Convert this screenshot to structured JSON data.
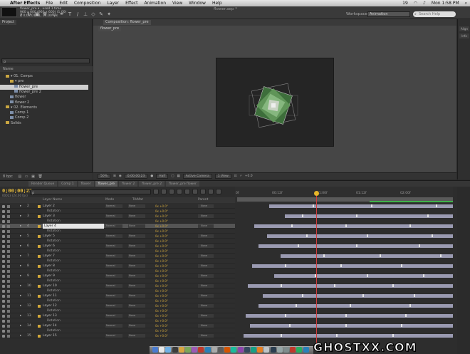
{
  "menubar": {
    "app": "After Effects",
    "items": [
      "File",
      "Edit",
      "Composition",
      "Layer",
      "Effect",
      "Animation",
      "View",
      "Window",
      "Help"
    ],
    "status": "19",
    "clock": "Mon 1:58 PM"
  },
  "window": {
    "title": "flower.aep *"
  },
  "toolbar": {
    "workspace_label": "Workspace:",
    "workspace_value": "Animation",
    "search_placeholder": "Search Help"
  },
  "project": {
    "tab": "Project",
    "info_lines": [
      "flower_pre ▾ , used 1 time",
      "960 x 600 (960 x 600) (1.00)",
      "Δ 0;00;01;01, 24.00 fps"
    ],
    "search_value": "ρ",
    "header_name": "Name",
    "tree": [
      {
        "label": "▾ 01. Comps",
        "kind": "folder",
        "indent": 1
      },
      {
        "label": "▾ pre",
        "kind": "folder",
        "indent": 2
      },
      {
        "label": "flower_pre",
        "kind": "comp",
        "indent": 3,
        "selected": true
      },
      {
        "label": "flower_pre 2",
        "kind": "comp",
        "indent": 3
      },
      {
        "label": "flower",
        "kind": "comp",
        "indent": 2
      },
      {
        "label": "flower 2",
        "kind": "comp",
        "indent": 2
      },
      {
        "label": "▾ 02. Elements",
        "kind": "folder",
        "indent": 1
      },
      {
        "label": "Comp 1",
        "kind": "comp",
        "indent": 2
      },
      {
        "label": "Comp 2",
        "kind": "comp",
        "indent": 2
      },
      {
        "label": "Solids",
        "kind": "folder",
        "indent": 1
      }
    ],
    "footer": "8 bpc"
  },
  "viewer": {
    "tab_label": "Composition: flower_pre",
    "subtab": "flower_pre",
    "footer": {
      "zoom": "50%",
      "time": "0;00;00;23",
      "quality": "Half",
      "camera": "Active Camera",
      "views": "1 View",
      "offset": "+0.0"
    }
  },
  "right_panel": {
    "tabs": [
      "Align",
      "Info"
    ]
  },
  "timeline": {
    "tabs": [
      "Render Queue",
      "Comp 1",
      "flower",
      "flower_pre",
      "flower 2",
      "flower_pre 2",
      "flower_pre flower"
    ],
    "active_tab_index": 3,
    "timecode": "0;00;00;23",
    "fps": "00023 (24.00 fps)",
    "search_value": "ρ",
    "columns": {
      "layer_name": "Layer Name",
      "mode": "Mode",
      "trkmat": "TrkMat",
      "parent": "Parent"
    },
    "ruler_labels": [
      "0f",
      "00:12f",
      "01:00f",
      "01:12f",
      "02:00f"
    ],
    "rows": [
      {
        "num": "2",
        "name": "Layer 2",
        "mode": "Normal",
        "trk": "None",
        "val": "0x +0.0°",
        "par": "None",
        "bar": [
          0.15,
          1.0
        ],
        "kfs": [
          0.35,
          0.62,
          0.92
        ]
      },
      {
        "name": "Rotation",
        "prop": true,
        "val": "0x +0.0°"
      },
      {
        "num": "3",
        "name": "Layer 3",
        "mode": "Normal",
        "trk": "None",
        "val": "0x +0.0°",
        "par": "None",
        "bar": [
          0.22,
          1.0
        ],
        "kfs": [
          0.3,
          0.55,
          0.88
        ]
      },
      {
        "name": "Rotation",
        "prop": true,
        "val": "0x +0.0°"
      },
      {
        "num": "4",
        "name": "Layer 4",
        "mode": "Normal",
        "trk": "None",
        "val": "0x +0.0°",
        "par": "None",
        "bar": [
          0.08,
          1.0
        ],
        "kfs": [
          0.25,
          0.5,
          0.8
        ],
        "selected": true
      },
      {
        "name": "Rotation",
        "prop": true,
        "val": "0x +0.0°"
      },
      {
        "num": "5",
        "name": "Layer 5",
        "mode": "Normal",
        "trk": "None",
        "val": "0x +0.0°",
        "par": "None",
        "bar": [
          0.14,
          1.0
        ],
        "kfs": [
          0.32,
          0.6,
          0.9
        ]
      },
      {
        "name": "Rotation",
        "prop": true,
        "val": "0x +0.0°"
      },
      {
        "num": "6",
        "name": "Layer 6",
        "mode": "Normal",
        "trk": "None",
        "val": "0x +0.0°",
        "par": "None",
        "bar": [
          0.1,
          1.0
        ],
        "kfs": [
          0.28,
          0.55,
          0.84
        ]
      },
      {
        "name": "Rotation",
        "prop": true,
        "val": "0x +0.0°"
      },
      {
        "num": "7",
        "name": "Layer 7",
        "mode": "Normal",
        "trk": "None",
        "val": "0x +0.0°",
        "par": "None",
        "bar": [
          0.2,
          1.0
        ],
        "kfs": [
          0.4,
          0.66,
          0.94
        ]
      },
      {
        "name": "Rotation",
        "prop": true,
        "val": "0x +0.0°"
      },
      {
        "num": "8",
        "name": "Layer 8",
        "mode": "Normal",
        "trk": "None",
        "val": "0x +0.0°",
        "par": "None",
        "bar": [
          0.07,
          1.0
        ],
        "kfs": [
          0.22,
          0.48,
          0.76
        ]
      },
      {
        "name": "Rotation",
        "prop": true,
        "val": "0x +0.0°"
      },
      {
        "num": "9",
        "name": "Layer 9",
        "mode": "Normal",
        "trk": "None",
        "val": "0x +0.0°",
        "par": "None",
        "bar": [
          0.17,
          1.0
        ],
        "kfs": [
          0.36,
          0.6,
          0.86
        ]
      },
      {
        "name": "Rotation",
        "prop": true,
        "val": "0x +0.0°"
      },
      {
        "num": "10",
        "name": "Layer 10",
        "mode": "Normal",
        "trk": "None",
        "val": "0x +0.0°",
        "par": "None",
        "bar": [
          0.05,
          1.0
        ],
        "kfs": [
          0.2,
          0.45,
          0.72
        ]
      },
      {
        "name": "Rotation",
        "prop": true,
        "val": "0x +0.0°"
      },
      {
        "num": "11",
        "name": "Layer 11",
        "mode": "Normal",
        "trk": "None",
        "val": "0x +0.0°",
        "par": "None",
        "bar": [
          0.12,
          1.0
        ],
        "kfs": [
          0.3,
          0.58,
          0.82
        ]
      },
      {
        "name": "Rotation",
        "prop": true,
        "val": "0x +0.0°"
      },
      {
        "num": "12",
        "name": "Layer 12",
        "mode": "Normal",
        "trk": "None",
        "val": "0x +0.0°",
        "par": "None",
        "bar": [
          0.1,
          1.0
        ],
        "kfs": [
          0.27,
          0.52,
          0.8
        ]
      },
      {
        "name": "Rotation",
        "prop": true,
        "val": "0x +0.0°"
      },
      {
        "num": "13",
        "name": "Layer 13",
        "mode": "Normal",
        "trk": "None",
        "val": "0x +0.0°",
        "par": "None",
        "bar": [
          0.04,
          1.0
        ],
        "kfs": [
          0.22,
          0.5,
          0.78
        ]
      },
      {
        "name": "Rotation",
        "prop": true,
        "val": "0x +0.0°"
      },
      {
        "num": "14",
        "name": "Layer 14",
        "mode": "Normal",
        "trk": "None",
        "val": "0x +0.0°",
        "par": "None",
        "bar": [
          0.06,
          1.0
        ],
        "kfs": [
          0.24,
          0.5,
          0.76
        ]
      },
      {
        "name": "Rotation",
        "prop": true,
        "val": "0x +0.0°"
      },
      {
        "num": "15",
        "name": "Layer 15",
        "mode": "Normal",
        "trk": "None",
        "val": "0x +0.0°",
        "par": "None",
        "bar": [
          0.03,
          1.0
        ],
        "kfs": [
          0.2,
          0.46,
          0.72
        ]
      }
    ]
  },
  "colors": {
    "timecode": "#e3b93c",
    "bar": "#9a9ab1",
    "cti": "#cf3d3d",
    "work_area_green": "#3fb24a",
    "label_yellow": "#cfa63b"
  },
  "watermark": "GHOSTXX.COM"
}
